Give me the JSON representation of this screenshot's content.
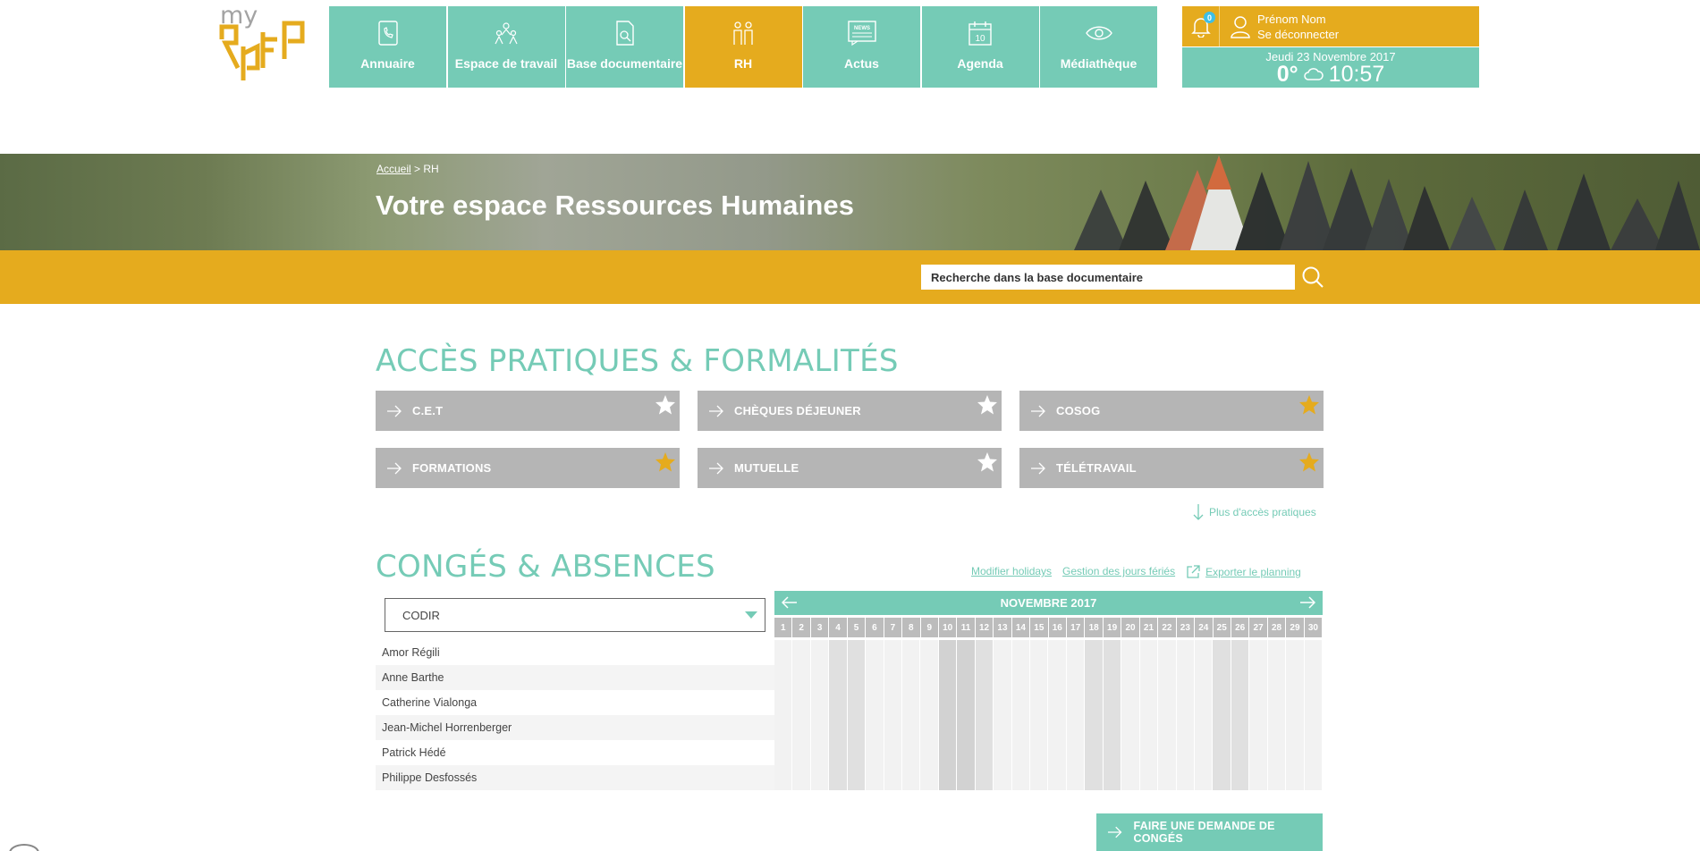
{
  "logo": {
    "my": "my",
    "brand": "RAFP"
  },
  "nav": [
    {
      "label": "Annuaire",
      "icon": "phone-book-icon"
    },
    {
      "label": "Espace de travail",
      "icon": "team-icon"
    },
    {
      "label": "Base documentaire",
      "icon": "document-search-icon"
    },
    {
      "label": "RH",
      "icon": "people-icon",
      "active": true
    },
    {
      "label": "Actus",
      "icon": "news-icon"
    },
    {
      "label": "Agenda",
      "icon": "calendar-icon"
    },
    {
      "label": "Médiathèque",
      "icon": "eye-icon"
    }
  ],
  "user": {
    "notifications": "0",
    "name": "Prénom Nom",
    "logout": "Se déconnecter",
    "date": "Jeudi 23 Novembre 2017",
    "temperature": "0°",
    "time": "10:57"
  },
  "banner": {
    "breadcrumb_home": "Accueil",
    "breadcrumb_sep": ">",
    "breadcrumb_current": "RH",
    "title": "Votre espace Ressources Humaines"
  },
  "search": {
    "placeholder": "Recherche dans la base documentaire"
  },
  "access": {
    "title": "ACCÈS PRATIQUES & FORMALITÉS",
    "tiles": [
      {
        "label": "C.E.T",
        "favorite": false
      },
      {
        "label": "CHÈQUES DÉJEUNER",
        "favorite": false
      },
      {
        "label": "COSOG",
        "favorite": true
      },
      {
        "label": "FORMATIONS",
        "favorite": true
      },
      {
        "label": "MUTUELLE",
        "favorite": false
      },
      {
        "label": "TÉLÉTRAVAIL",
        "favorite": true
      }
    ],
    "more": "Plus d'accès pratiques"
  },
  "absences": {
    "title": "CONGÉS & ABSENCES",
    "links": [
      "Modifier holidays",
      "Gestion des jours fériés",
      "Exporter le planning"
    ],
    "group": "CODIR",
    "month": "NOVEMBRE 2017",
    "days": [
      "1",
      "2",
      "3",
      "4",
      "5",
      "6",
      "7",
      "8",
      "9",
      "10",
      "11",
      "12",
      "13",
      "14",
      "15",
      "16",
      "17",
      "18",
      "19",
      "20",
      "21",
      "22",
      "23",
      "24",
      "25",
      "26",
      "27",
      "28",
      "29",
      "30"
    ],
    "people": [
      "Amor Régili",
      "Anne Barthe",
      "Catherine Vialonga",
      "Jean-Michel Horrenberger",
      "Patrick Hédé",
      "Philippe Desfossés"
    ],
    "cta": "FAIRE UNE DEMANDE DE CONGÉS"
  },
  "colors": {
    "teal": "#75cbb6",
    "gold": "#e5ab1e",
    "grey_tile": "#b5b5b5"
  }
}
